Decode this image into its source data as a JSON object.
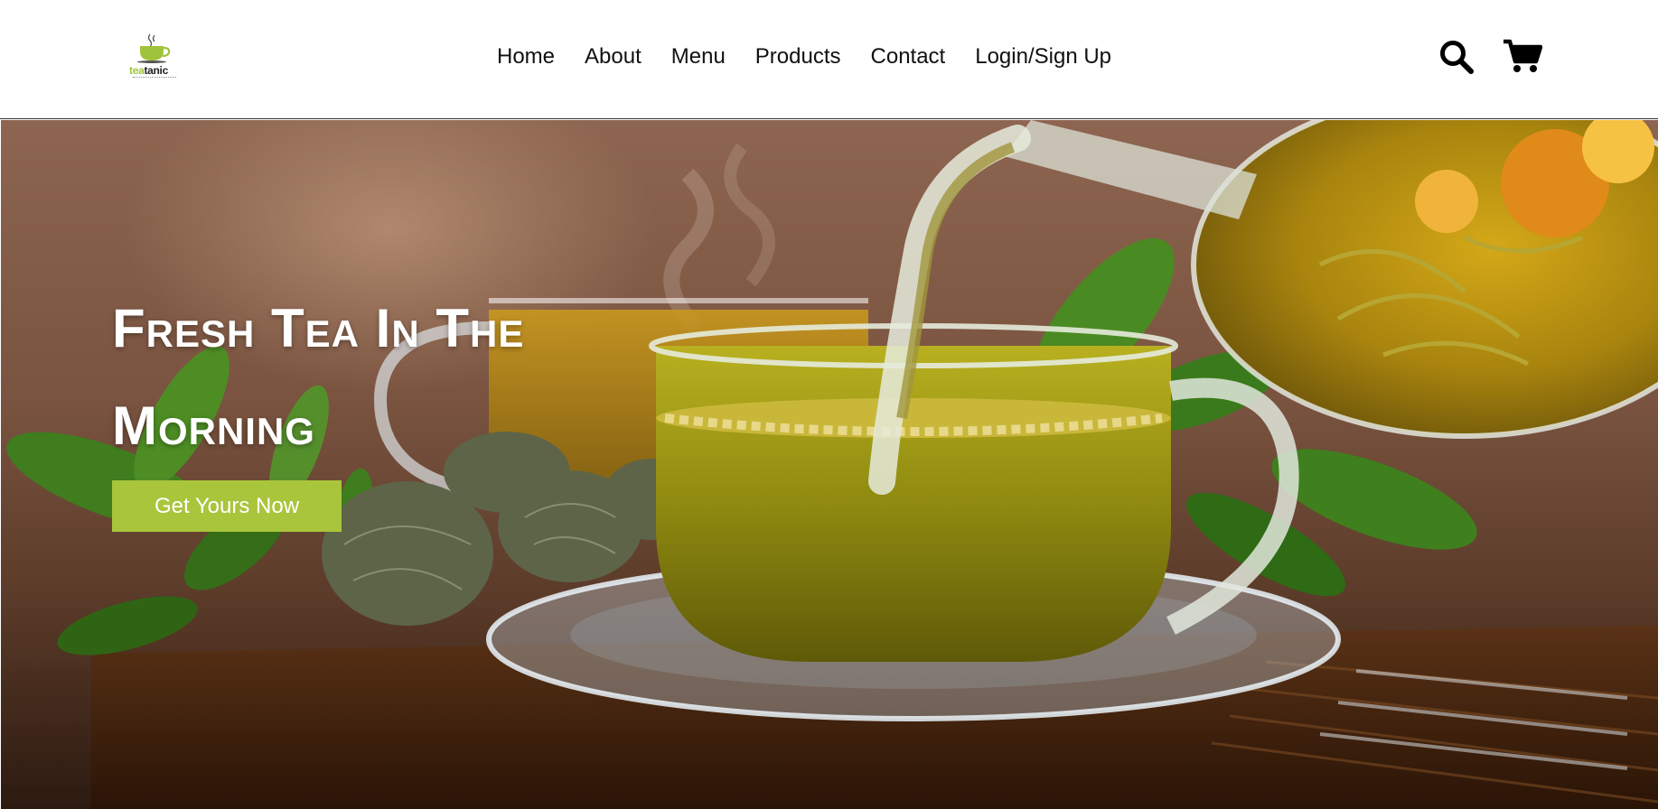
{
  "brand": {
    "logo_text_tea": "tea",
    "logo_text_tanic": "tanic",
    "colors": {
      "accent": "#a9c53c",
      "text": "#111111"
    }
  },
  "nav": {
    "items": [
      {
        "label": "Home"
      },
      {
        "label": "About"
      },
      {
        "label": "Menu"
      },
      {
        "label": "Products"
      },
      {
        "label": "Contact"
      },
      {
        "label": "Login/Sign Up"
      }
    ]
  },
  "header_icons": {
    "search": "search-icon",
    "cart": "shopping-cart-icon"
  },
  "hero": {
    "title_line1": "Fresh Tea In The",
    "title_line2": "Morning",
    "cta_label": "Get Yours Now"
  }
}
